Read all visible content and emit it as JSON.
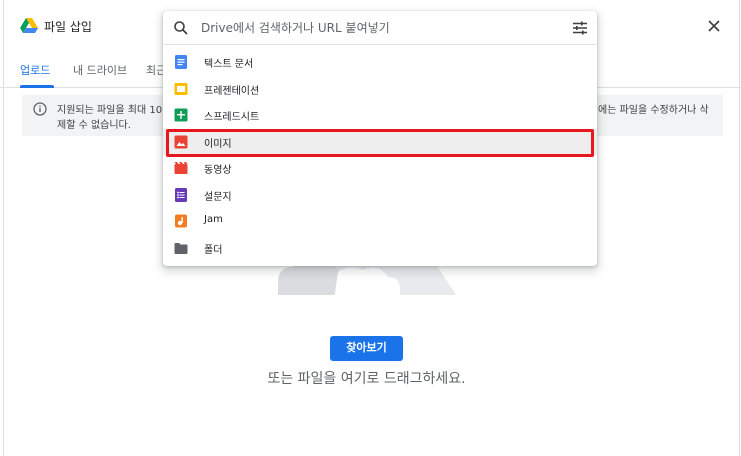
{
  "header": {
    "title": "파일 삽입"
  },
  "tabs": [
    {
      "label": "업로드",
      "active": true
    },
    {
      "label": "내 드라이브",
      "active": false
    },
    {
      "label": "최근",
      "active": false
    }
  ],
  "info": {
    "line1_start": "지원되는 파일을 최대 10",
    "line1_end": "에는 파일을 수정하거나 삭",
    "line2_start": "제할 수 없습니다.",
    "line2_end": "삭"
  },
  "search": {
    "placeholder": "Drive에서 검색하거나 URL 붙여넣기",
    "value": ""
  },
  "menu": {
    "items": [
      {
        "label": "텍스트 문서",
        "icon": "docs-icon",
        "color": "#4285f4"
      },
      {
        "label": "프레젠테이션",
        "icon": "slides-icon",
        "color": "#fbbc04"
      },
      {
        "label": "스프레드시트",
        "icon": "sheets-icon",
        "color": "#0f9d58"
      },
      {
        "label": "이미지",
        "icon": "image-icon",
        "color": "#ea4335"
      },
      {
        "label": "동영상",
        "icon": "video-icon",
        "color": "#ea4335"
      },
      {
        "label": "설문지",
        "icon": "forms-icon",
        "color": "#673ab7"
      },
      {
        "label": "Jam",
        "icon": "jamboard-icon",
        "color": "#f37c20"
      },
      {
        "label": "폴더",
        "icon": "folder-icon",
        "color": "#5f6368"
      }
    ],
    "selected_index": 3
  },
  "main": {
    "browse_label": "찾아보기",
    "drag_text": "또는 파일을 여기로 드래그하세요."
  },
  "colors": {
    "accent": "#1a73e8",
    "highlight": "#e8161e"
  }
}
